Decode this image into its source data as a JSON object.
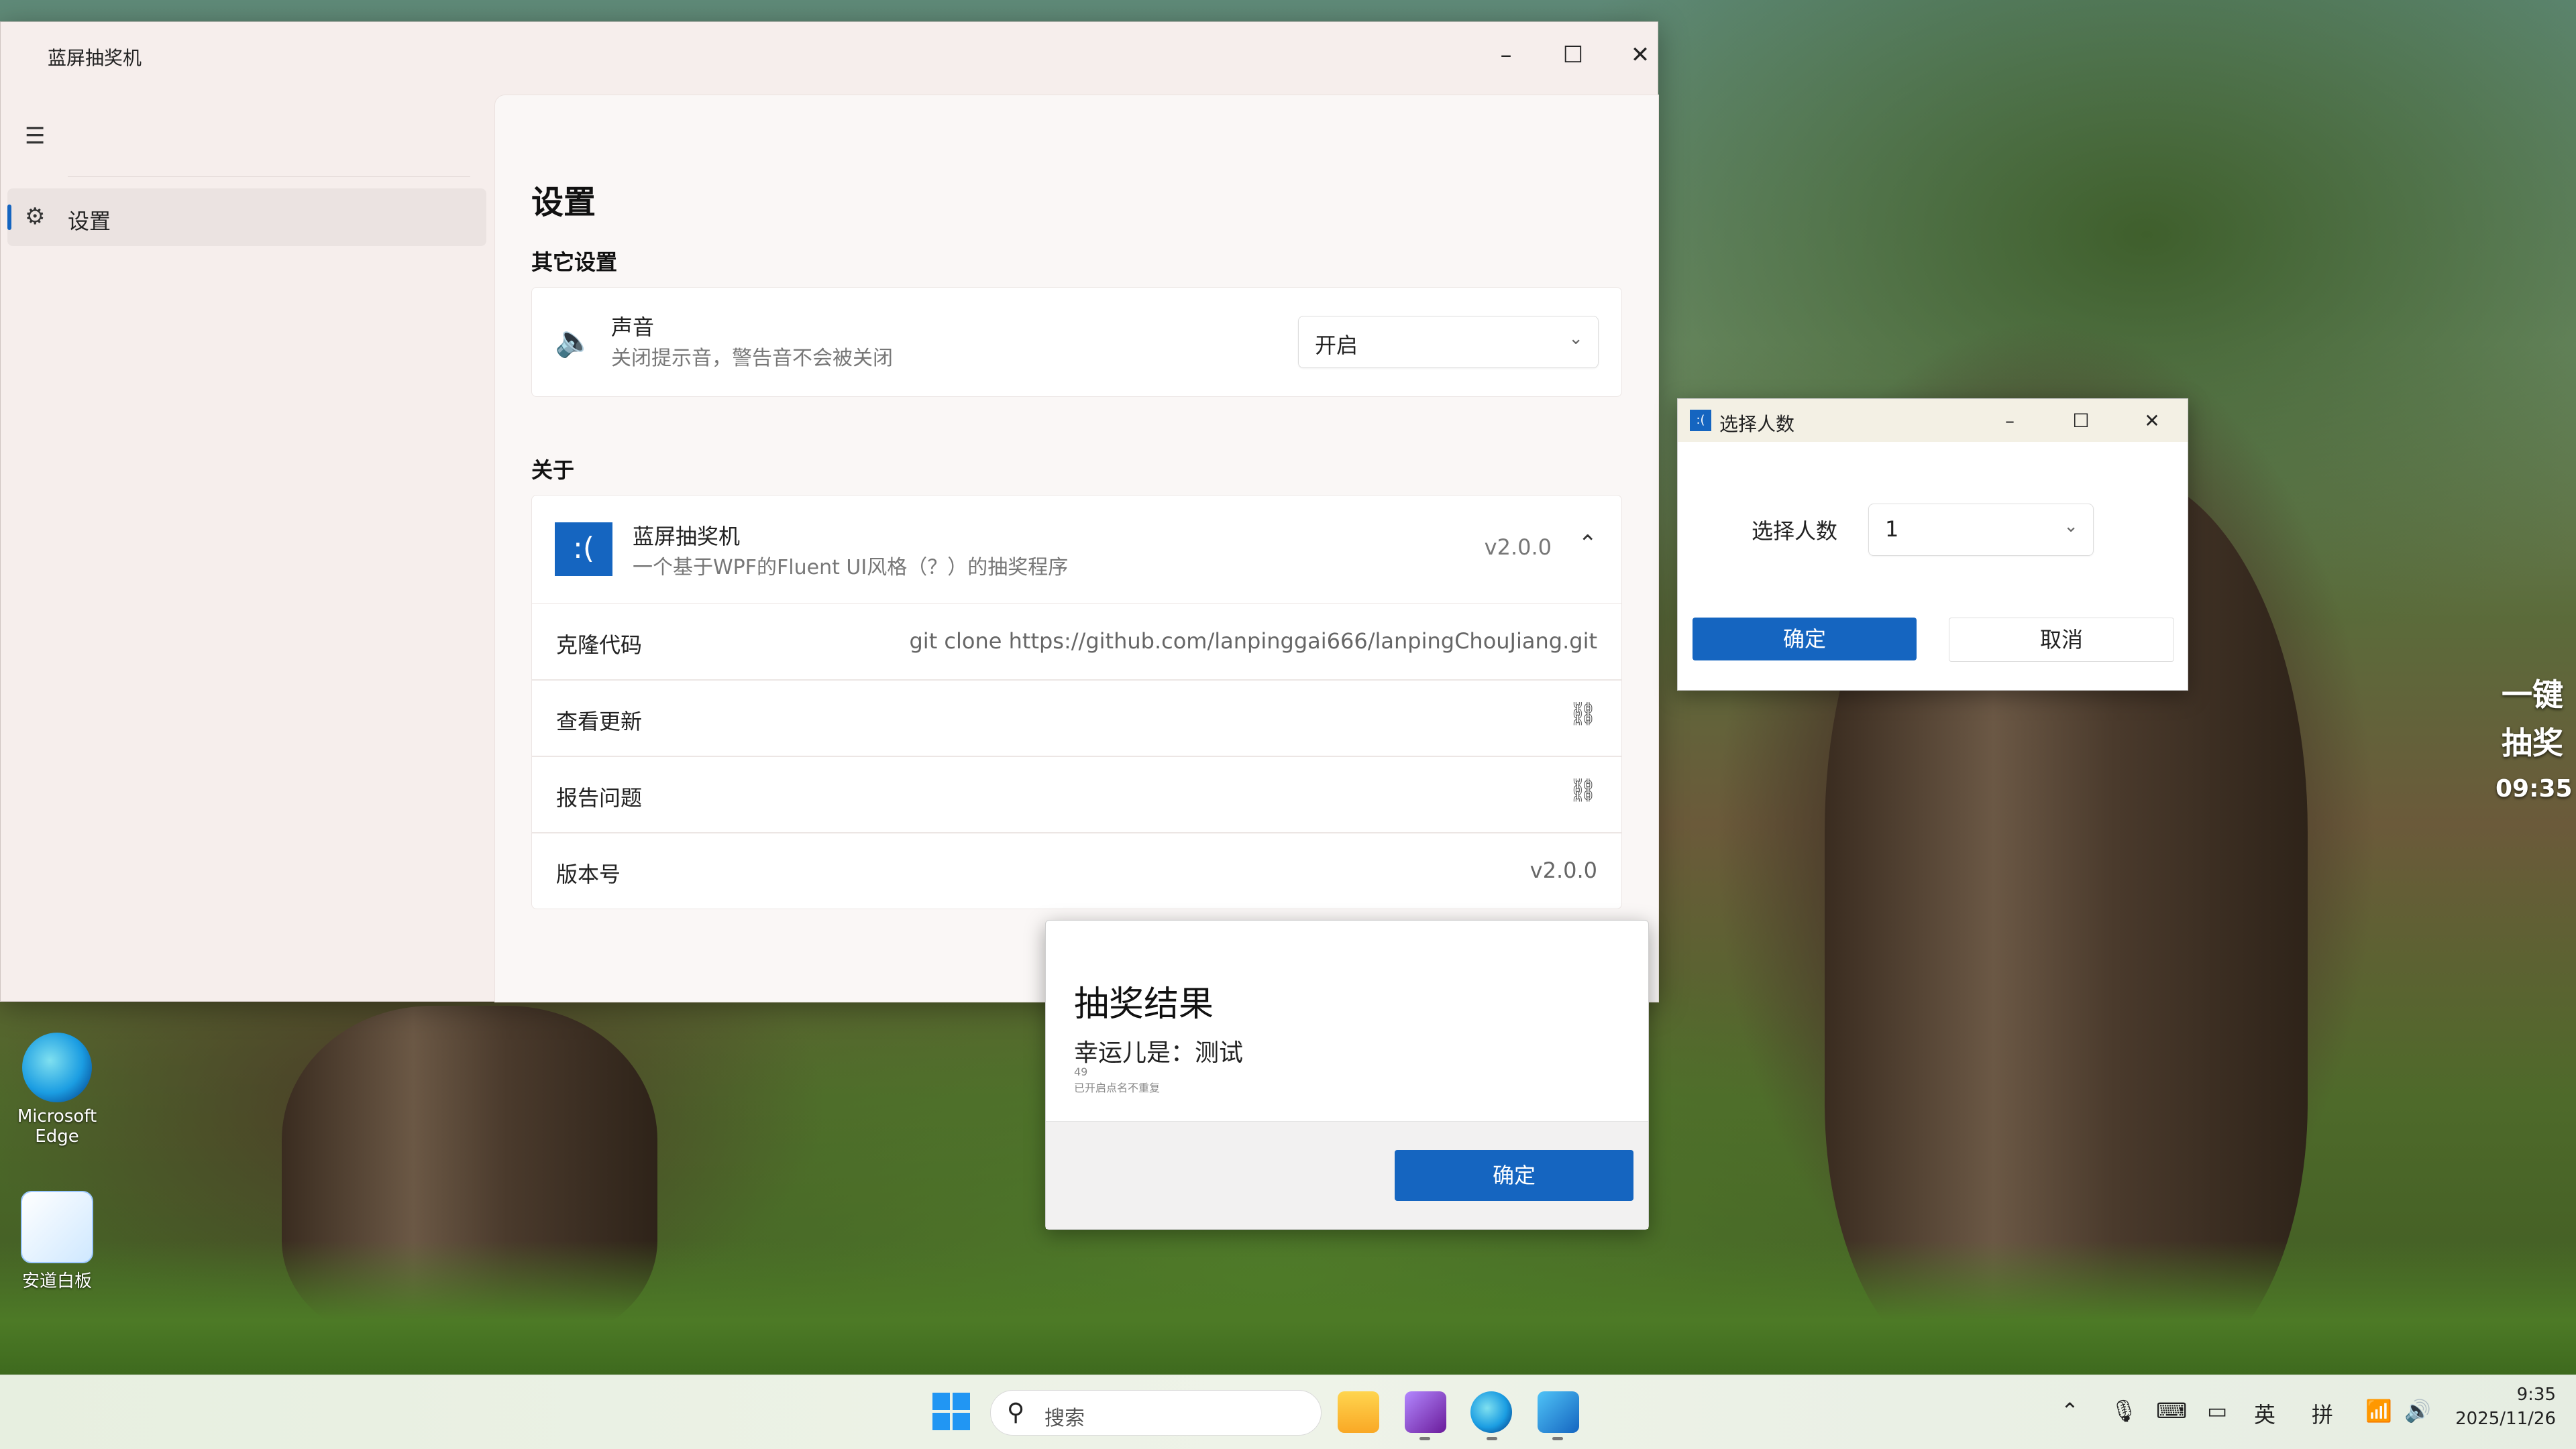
{
  "main_window": {
    "title": "蓝屏抽奖机",
    "nav": {
      "settings_label": "设置"
    },
    "page_title": "设置",
    "section_other": "其它设置",
    "sound": {
      "title": "声音",
      "desc": "关闭提示音，警告音不会被关闭",
      "value": "开启"
    },
    "section_about": "关于",
    "about": {
      "app_icon_text": ":(",
      "app_name": "蓝屏抽奖机",
      "app_desc": "一个基于WPF的Fluent UI风格（？）的抽奖程序",
      "version": "v2.0.0"
    },
    "rows": {
      "clone_label": "克隆代码",
      "clone_value": "git clone https://github.com/lanpinggai666/lanpingChouJiang.git",
      "update_label": "查看更新",
      "report_label": "报告问题",
      "version_label": "版本号",
      "version_value": "v2.0.0"
    }
  },
  "select_window": {
    "icon_text": ":(",
    "title": "选择人数",
    "field_label": "选择人数",
    "field_value": "1",
    "ok_label": "确定",
    "cancel_label": "取消"
  },
  "result_dialog": {
    "title": "抽奖结果",
    "message": "幸运儿是：测试",
    "small_number": "49",
    "small_note": "已开启点名不重复",
    "ok_label": "确定"
  },
  "side_overlay": {
    "line1": "一键",
    "line2": "抽奖",
    "time": "09:35"
  },
  "desktop_icons": [
    {
      "label_line1": "Microsoft",
      "label_line2": "Edge"
    },
    {
      "label_line1": "安道白板",
      "label_line2": ""
    }
  ],
  "taskbar": {
    "search_placeholder": "搜索",
    "ime_lang": "英",
    "ime_mode": "拼",
    "time": "9:35",
    "date": "2025/11/26"
  },
  "colors": {
    "accent": "#1565c0"
  }
}
